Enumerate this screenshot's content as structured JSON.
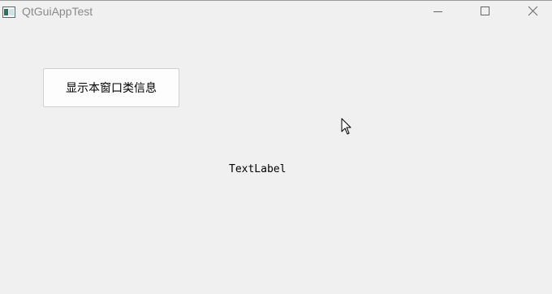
{
  "window": {
    "title": "QtGuiAppTest",
    "icon": "app-window-icon",
    "controls": [
      "minimize-icon",
      "maximize-icon",
      "close-icon"
    ]
  },
  "main": {
    "button_label": "显示本窗口类信息",
    "text_label": "TextLabel"
  },
  "colors": {
    "background": "#f0f0f0",
    "title_text": "#8a8a8a",
    "button_bg": "#fdfdfd",
    "button_border": "#d0d0d0"
  }
}
